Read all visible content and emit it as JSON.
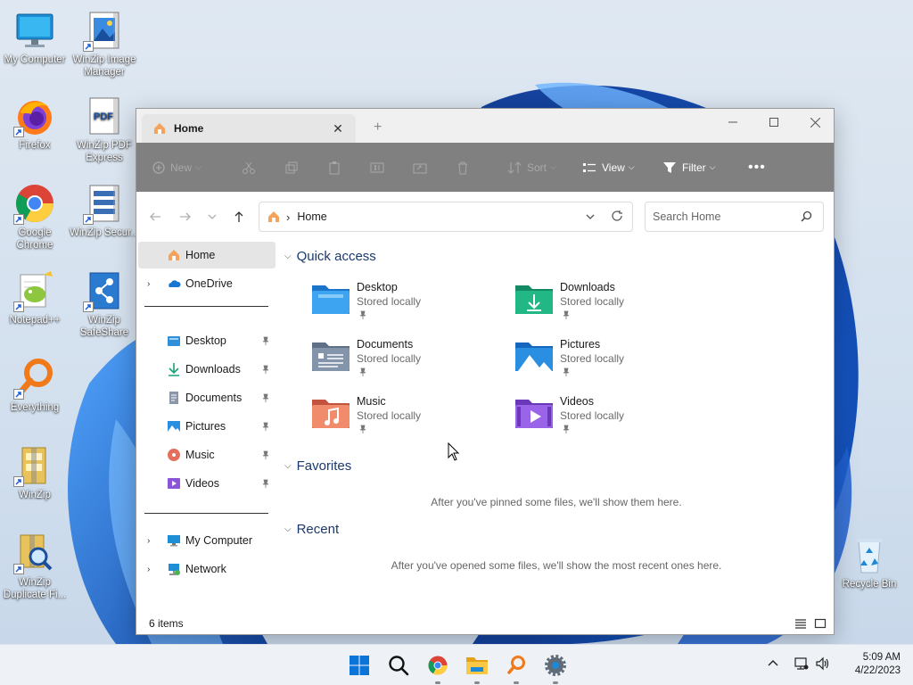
{
  "desktop": {
    "icons": [
      {
        "label": "My Computer",
        "icon": "monitor-icon"
      },
      {
        "label": "WinZip Image Manager",
        "icon": "winzip-image-icon"
      },
      {
        "label": "Firefox",
        "icon": "firefox-icon"
      },
      {
        "label": "WinZip PDF Express",
        "icon": "pdf-icon"
      },
      {
        "label": "Google Chrome",
        "icon": "chrome-icon"
      },
      {
        "label": "WinZip Secur...",
        "icon": "winzip-secure-icon"
      },
      {
        "label": "Notepad++",
        "icon": "notepadpp-icon"
      },
      {
        "label": "WinZip SafeShare",
        "icon": "safeshare-icon"
      },
      {
        "label": "Everything",
        "icon": "everything-icon"
      },
      {
        "label": "WinZip",
        "icon": "winzip-icon"
      },
      {
        "label": "WinZip Duplicate Fi...",
        "icon": "duplicate-finder-icon"
      },
      {
        "label": "Recycle Bin",
        "icon": "recycle-bin-icon"
      }
    ]
  },
  "window": {
    "tab_title": "Home",
    "toolbar": {
      "new_label": "New",
      "sort_label": "Sort",
      "view_label": "View",
      "filter_label": "Filter"
    },
    "address": {
      "crumb": "Home"
    },
    "search": {
      "placeholder": "Search Home"
    },
    "nav": {
      "home": "Home",
      "onedrive": "OneDrive",
      "pinned": [
        {
          "label": "Desktop",
          "icon": "desktop-folder-icon"
        },
        {
          "label": "Downloads",
          "icon": "downloads-icon"
        },
        {
          "label": "Documents",
          "icon": "documents-icon"
        },
        {
          "label": "Pictures",
          "icon": "pictures-icon"
        },
        {
          "label": "Music",
          "icon": "music-icon"
        },
        {
          "label": "Videos",
          "icon": "videos-icon"
        }
      ],
      "my_computer": "My Computer",
      "network": "Network"
    },
    "content": {
      "quick_access_title": "Quick access",
      "items": [
        {
          "name": "Desktop",
          "sub": "Stored locally",
          "color": "#2f8fd8"
        },
        {
          "name": "Downloads",
          "sub": "Stored locally",
          "color": "#1aa37a"
        },
        {
          "name": "Documents",
          "sub": "Stored locally",
          "color": "#7d8da3"
        },
        {
          "name": "Pictures",
          "sub": "Stored locally",
          "color": "#2a8fe0"
        },
        {
          "name": "Music",
          "sub": "Stored locally",
          "color": "#e46f5c"
        },
        {
          "name": "Videos",
          "sub": "Stored locally",
          "color": "#8a55d6"
        }
      ],
      "favorites_title": "Favorites",
      "favorites_empty": "After you've pinned some files, we'll show them here.",
      "recent_title": "Recent",
      "recent_empty": "After you've opened some files, we'll show the most recent ones here."
    },
    "status": {
      "item_count": "6 items"
    }
  },
  "taskbar": {
    "apps": [
      "start-icon",
      "search-icon",
      "chrome-icon",
      "file-explorer-icon",
      "everything-icon",
      "settings-icon"
    ],
    "time": "5:09 AM",
    "date": "4/22/2023"
  }
}
